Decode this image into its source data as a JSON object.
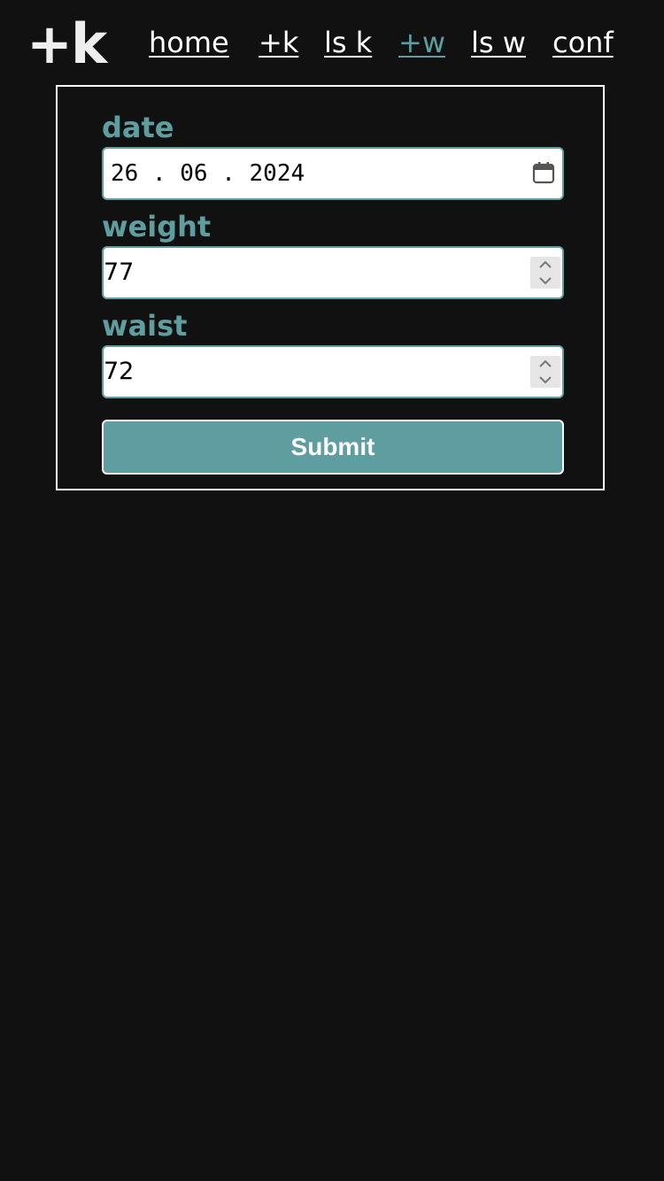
{
  "header": {
    "logo": "+k",
    "nav": [
      {
        "label": "home",
        "active": false
      },
      {
        "label": "+k",
        "active": false
      },
      {
        "label": "ls k",
        "active": false
      },
      {
        "label": "+w",
        "active": true
      },
      {
        "label": "ls w",
        "active": false
      },
      {
        "label": "conf",
        "active": false
      }
    ]
  },
  "form": {
    "date": {
      "label": "date",
      "value": "26 . 06 . 2024",
      "icon": "calendar-icon"
    },
    "weight": {
      "label": "weight",
      "value": "77"
    },
    "waist": {
      "label": "waist",
      "value": "72"
    },
    "submit_label": "Submit"
  },
  "colors": {
    "background": "#111111",
    "accent": "#5f9ea0",
    "text": "#ffffff"
  }
}
